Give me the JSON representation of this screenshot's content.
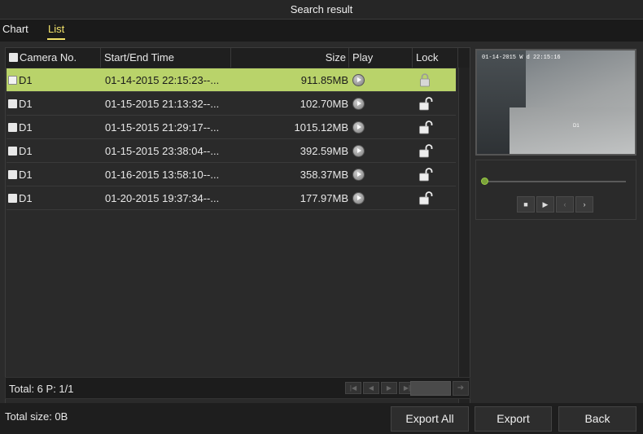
{
  "window": {
    "title": "Search result"
  },
  "tabs": [
    {
      "label": "Chart"
    },
    {
      "label": "List"
    }
  ],
  "table": {
    "headers": {
      "camera": "Camera No.",
      "time": "Start/End Time",
      "size": "Size",
      "play": "Play",
      "lock": "Lock"
    },
    "rows": [
      {
        "camera": "D1",
        "time": "01-14-2015 22:15:23--...",
        "size": "911.85MB",
        "locked": true
      },
      {
        "camera": "D1",
        "time": "01-15-2015 21:13:32--...",
        "size": "102.70MB",
        "locked": false
      },
      {
        "camera": "D1",
        "time": "01-15-2015 21:29:17--...",
        "size": "1015.12MB",
        "locked": false
      },
      {
        "camera": "D1",
        "time": "01-15-2015 23:38:04--...",
        "size": "392.59MB",
        "locked": false
      },
      {
        "camera": "D1",
        "time": "01-16-2015 13:58:10--...",
        "size": "358.37MB",
        "locked": false
      },
      {
        "camera": "D1",
        "time": "01-20-2015 19:37:34--...",
        "size": "177.97MB",
        "locked": false
      }
    ],
    "selected_row": 0
  },
  "footer": {
    "total": "Total: 6  P: 1/1",
    "page_input": ""
  },
  "preview": {
    "timestamp": "01-14-2015 W d 22:15:16",
    "camera_label": "D1"
  },
  "bottom": {
    "total_size": "Total size: 0B",
    "export_all": "Export All",
    "export": "Export",
    "back": "Back"
  },
  "colors": {
    "selected_row": "#b9d36a",
    "active_tab": "#f2e26a",
    "slider_knob": "#7ba23a"
  }
}
